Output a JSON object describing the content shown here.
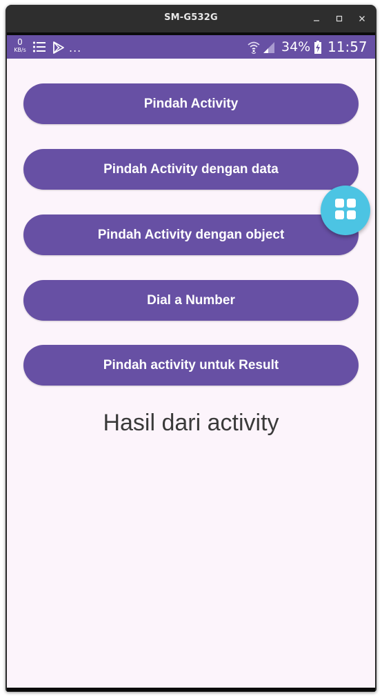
{
  "window": {
    "title": "SM-G532G"
  },
  "statusbar": {
    "speed_value": "0",
    "speed_unit": "KB/s",
    "more": "...",
    "battery_percent": "34%",
    "time": "11:57",
    "icons": [
      "list-icon",
      "play-store-icon",
      "wifi-icon",
      "signal-icon",
      "battery-charging-icon"
    ]
  },
  "main": {
    "buttons": [
      {
        "label": "Pindah Activity"
      },
      {
        "label": "Pindah Activity dengan data"
      },
      {
        "label": "Pindah Activity dengan object"
      },
      {
        "label": "Dial a Number"
      },
      {
        "label": "Pindah activity untuk Result"
      }
    ],
    "result_text": "Hasil dari activity"
  },
  "fab": {
    "icon": "grid-apps-icon"
  },
  "colors": {
    "primary": "#6750a4",
    "background": "#fcf4fb",
    "fab": "#4cc4e3",
    "result_text": "#3a3a3a"
  }
}
